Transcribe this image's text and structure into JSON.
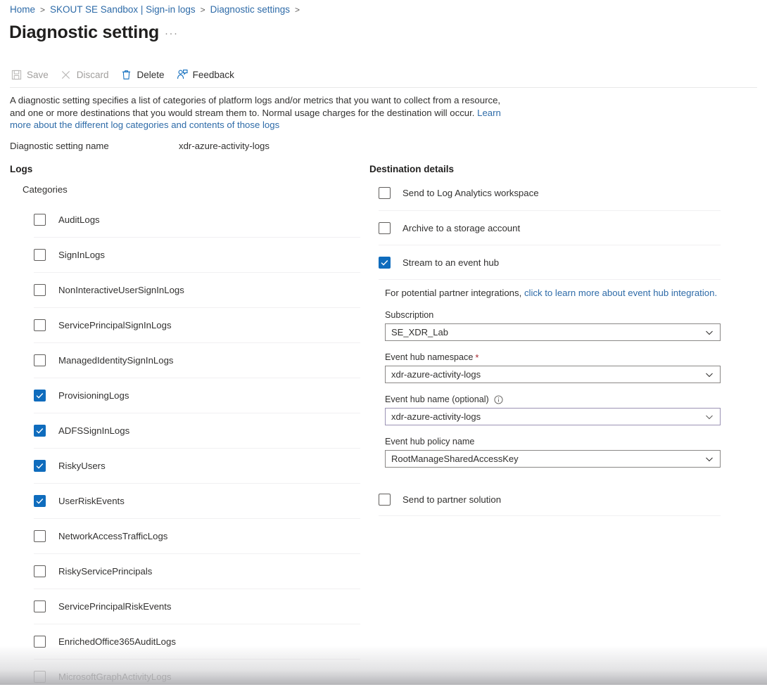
{
  "breadcrumb": {
    "items": [
      "Home",
      "SKOUT SE Sandbox | Sign-in logs",
      "Diagnostic settings"
    ],
    "separator": ">"
  },
  "header": {
    "title": "Diagnostic setting",
    "ellipsis": "···"
  },
  "toolbar": {
    "save_label": "Save",
    "discard_label": "Discard",
    "delete_label": "Delete",
    "feedback_label": "Feedback"
  },
  "description": {
    "text_part1": "A diagnostic setting specifies a list of categories of platform logs and/or metrics that you want to collect from a resource, and one or more destinations that you would stream them to. Normal usage charges for the destination will occur. ",
    "link_text": "Learn more about the different log categories and contents of those logs"
  },
  "setting_name": {
    "label": "Diagnostic setting name",
    "value": "xdr-azure-activity-logs"
  },
  "logs": {
    "heading": "Logs",
    "categories_label": "Categories",
    "categories": [
      {
        "label": "AuditLogs",
        "checked": false
      },
      {
        "label": "SignInLogs",
        "checked": false
      },
      {
        "label": "NonInteractiveUserSignInLogs",
        "checked": false
      },
      {
        "label": "ServicePrincipalSignInLogs",
        "checked": false
      },
      {
        "label": "ManagedIdentitySignInLogs",
        "checked": false
      },
      {
        "label": "ProvisioningLogs",
        "checked": true
      },
      {
        "label": "ADFSSignInLogs",
        "checked": true
      },
      {
        "label": "RiskyUsers",
        "checked": true
      },
      {
        "label": "UserRiskEvents",
        "checked": true
      },
      {
        "label": "NetworkAccessTrafficLogs",
        "checked": false
      },
      {
        "label": "RiskyServicePrincipals",
        "checked": false
      },
      {
        "label": "ServicePrincipalRiskEvents",
        "checked": false
      },
      {
        "label": "EnrichedOffice365AuditLogs",
        "checked": false
      },
      {
        "label": "MicrosoftGraphActivityLogs",
        "checked": false
      }
    ]
  },
  "destination": {
    "heading": "Destination details",
    "options": [
      {
        "label": "Send to Log Analytics workspace",
        "checked": false
      },
      {
        "label": "Archive to a storage account",
        "checked": false
      },
      {
        "label": "Stream to an event hub",
        "checked": true
      }
    ],
    "partner_note_prefix": "For potential partner integrations, ",
    "partner_note_link": "click to learn more about event hub integration.",
    "fields": {
      "subscription": {
        "label": "Subscription",
        "value": "SE_XDR_Lab",
        "required": false,
        "focused": false
      },
      "namespace": {
        "label": "Event hub namespace",
        "value": "xdr-azure-activity-logs",
        "required": true,
        "required_marker": "*",
        "focused": false
      },
      "eventhub_name": {
        "label": "Event hub name (optional)",
        "value": "xdr-azure-activity-logs",
        "required": false,
        "focused": true,
        "has_info": true
      },
      "policy": {
        "label": "Event hub policy name",
        "value": "RootManageSharedAccessKey",
        "required": false,
        "focused": false
      }
    },
    "partner_solution": {
      "label": "Send to partner solution",
      "checked": false
    }
  },
  "colors": {
    "accent_blue": "#0f6cbd",
    "link_blue": "#2e6ba8",
    "text": "#323130",
    "disabled_text": "#a19f9d",
    "required_red": "#a4262c",
    "focus_purple": "#9b92b4",
    "divider": "#f1f0f2"
  }
}
